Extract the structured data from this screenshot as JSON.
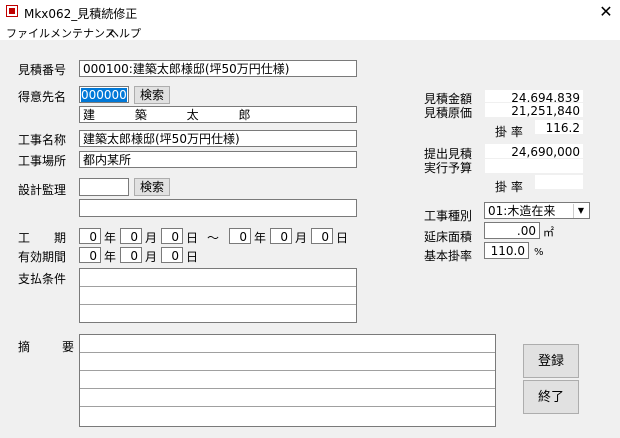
{
  "window": {
    "title": "Mkx062_見積続修正",
    "close": "✕"
  },
  "menu": [
    "ファイル",
    "メンテナンス",
    "ヘルプ"
  ],
  "labels": {
    "estimate_no": "見積番号",
    "customer": "得意先名",
    "project_name": "工事名称",
    "site": "工事場所",
    "design_supervision": "設計監理",
    "period": "工　期",
    "validity": "有効期間",
    "payment": "支払条件",
    "summary": "摘　要",
    "est_amount": "見積金額",
    "est_cost": "見積原価",
    "rate": "掛 率",
    "submitted_est": "提出見積",
    "budget": "実行予算",
    "rate2": "掛 率",
    "construction_type": "工事種別",
    "floor_area": "延床面積",
    "base_rate": "基本掛率",
    "year": "年",
    "month": "月",
    "day": "日",
    "tilde": "〜",
    "sqm": "㎡",
    "percent": "%"
  },
  "fields": {
    "estimate_no": "000100:建築太郎様邸(坪50万円仕様)",
    "customer_code": "000000",
    "customer_name": "建 築 太 郎",
    "project_name": "建築太郎様邸(坪50万円仕様)",
    "site": "都内某所",
    "design_code": "",
    "design_name": "",
    "period_start_y": "0",
    "period_start_m": "0",
    "period_start_d": "0",
    "period_end_y": "0",
    "period_end_m": "0",
    "period_end_d": "0",
    "valid_y": "0",
    "valid_m": "0",
    "valid_d": "0",
    "est_amount": "24,694,839",
    "est_cost": "21,251,840",
    "rate": "116.2",
    "submitted_est": "24,690,000",
    "budget": "",
    "rate2": "",
    "construction_type": "01:木造在来",
    "floor_area": ".00",
    "base_rate": "110.0"
  },
  "buttons": {
    "search1": "検索",
    "search2": "検索",
    "register": "登録",
    "exit": "終了"
  }
}
